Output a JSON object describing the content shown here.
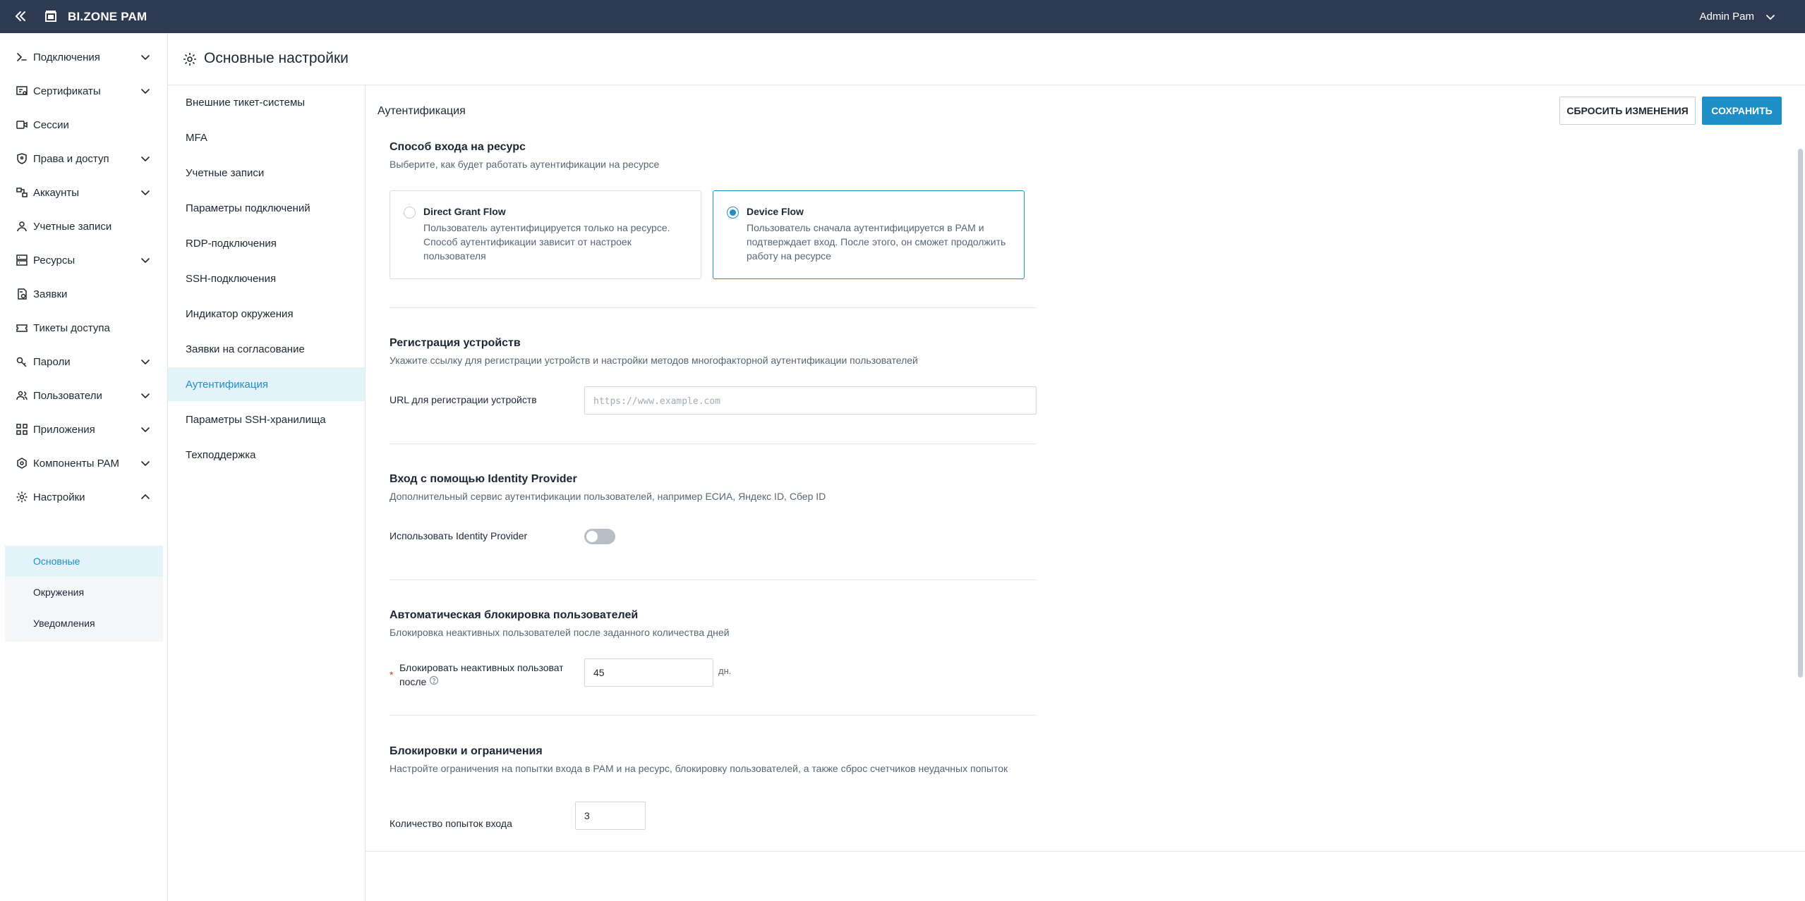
{
  "topbar": {
    "brand": "BI.ZONE PAM",
    "user_name": "Admin Pam"
  },
  "sidebar": {
    "items": [
      {
        "label": "Подключения",
        "icon": "connections-icon",
        "has_chevron": true
      },
      {
        "label": "Сертификаты",
        "icon": "certificate-icon",
        "has_chevron": true
      },
      {
        "label": "Сессии",
        "icon": "video-icon",
        "has_chevron": false
      },
      {
        "label": "Права и доступ",
        "icon": "shield-icon",
        "has_chevron": true
      },
      {
        "label": "Аккаунты",
        "icon": "accounts-icon",
        "has_chevron": true
      },
      {
        "label": "Учетные записи",
        "icon": "user-icon",
        "has_chevron": false
      },
      {
        "label": "Ресурсы",
        "icon": "server-icon",
        "has_chevron": true
      },
      {
        "label": "Заявки",
        "icon": "request-icon",
        "has_chevron": false
      },
      {
        "label": "Тикеты доступа",
        "icon": "ticket-icon",
        "has_chevron": false
      },
      {
        "label": "Пароли",
        "icon": "key-icon",
        "has_chevron": true
      },
      {
        "label": "Пользователи",
        "icon": "users-icon",
        "has_chevron": true
      },
      {
        "label": "Приложения",
        "icon": "apps-icon",
        "has_chevron": true
      },
      {
        "label": "Компоненты PAM",
        "icon": "components-icon",
        "has_chevron": true
      },
      {
        "label": "Настройки",
        "icon": "gear-icon",
        "has_chevron": true,
        "expanded": true
      }
    ],
    "settings_sub": [
      {
        "label": "Основные",
        "active": true
      },
      {
        "label": "Окружения",
        "active": false
      },
      {
        "label": "Уведомления",
        "active": false
      }
    ]
  },
  "page": {
    "title": "Основные настройки"
  },
  "subnav": {
    "items": [
      {
        "label": "Внешние тикет-системы"
      },
      {
        "label": "MFA"
      },
      {
        "label": "Учетные записи"
      },
      {
        "label": "Параметры подключений"
      },
      {
        "label": "RDP-подключения"
      },
      {
        "label": "SSH-подключения"
      },
      {
        "label": "Индикатор окружения"
      },
      {
        "label": "Заявки на согласование"
      },
      {
        "label": "Аутентификация",
        "active": true
      },
      {
        "label": "Параметры SSH-хранилища"
      },
      {
        "label": "Техподдержка"
      }
    ]
  },
  "content": {
    "title": "Аутентификация",
    "reset_label": "СБРОСИТЬ ИЗМЕНЕНИЯ",
    "save_label": "СОХРАНИТЬ",
    "login_method": {
      "title": "Способ входа на ресурс",
      "desc": "Выберите, как будет работать аутентификации на ресурсе",
      "options": [
        {
          "title": "Direct Grant Flow",
          "desc": "Пользователь аутентифицируется только на ресурсе. Способ аутентификации зависит от настроек пользователя",
          "selected": false
        },
        {
          "title": "Device Flow",
          "desc": "Пользователь сначала аутентифицируется в PAM и подтверждает вход. После этого, он сможет продолжить работу на ресурсе",
          "selected": true
        }
      ]
    },
    "device_registration": {
      "title": "Регистрация устройств",
      "desc": "Укажите ссылку для регистрации устройств и настройки методов многофакторной аутентификации пользователей",
      "url_label": "URL для регистрации устройств",
      "url_placeholder": "https://www.example.com",
      "url_value": ""
    },
    "identity_provider": {
      "title": "Вход с помощью Identity Provider",
      "desc": "Дополнительный сервис аутентификации пользователей, например ЕСИА, Яндекс ID, Сбер ID",
      "toggle_label": "Использовать Identity Provider",
      "enabled": false
    },
    "auto_block": {
      "title": "Автоматическая блокировка пользователей",
      "desc": "Блокировка неактивных пользователей после заданного количества дней",
      "label_line1": "Блокировать неактивных пользователей",
      "label_line2": "после",
      "value": "45",
      "unit": "дн."
    },
    "limits": {
      "title": "Блокировки и ограничения",
      "desc": "Настройте ограничения на попытки входа в PAM и на ресурс, блокировку пользователей, а также сброс счетчиков неудачных попыток",
      "attempts_label": "Количество попыток входа",
      "attempts_value": "3"
    }
  },
  "colors": {
    "topbar": "#2d3a52",
    "accent": "#1d8fc6",
    "active_bg": "#e4f2f9"
  }
}
